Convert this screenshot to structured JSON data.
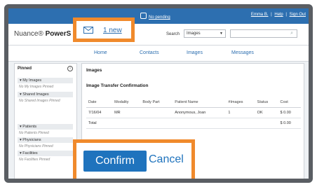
{
  "topbar": {
    "notification_text": "No pending",
    "user_link": "Emma B.",
    "help_link": "Help",
    "signout_link": "Sign Out"
  },
  "brand": {
    "prefix": "Nuance",
    "name": "PowerS"
  },
  "search": {
    "label": "Search",
    "selected": "Images",
    "placeholder": ""
  },
  "nav": {
    "home": "Home",
    "contacts": "Contacts",
    "images": "Images",
    "messages": "Messages"
  },
  "sidebar": {
    "title": "Pinned",
    "sections": [
      {
        "label": "▾ My Images",
        "empty": "No My Images Pinned"
      },
      {
        "label": "▾ Shared Images",
        "empty": "No Shared Images Pinned"
      },
      {
        "label": "▾ Patients",
        "empty": "No Patients Pinned"
      },
      {
        "label": "▾ Physicians",
        "empty": "No Physicians Pinned"
      },
      {
        "label": "▾ Facilities",
        "empty": "No Facilities Pinned"
      }
    ]
  },
  "main": {
    "title": "Images",
    "section": "Image Transfer Confirmation",
    "columns": [
      "Date",
      "Modality",
      "Body Part",
      "Patient Name",
      "#Images",
      "Status",
      "Cost"
    ],
    "rows": [
      [
        "7/16/04",
        "MR",
        "",
        "Anonymous, Joan",
        "1",
        "OK",
        "$ 0.00"
      ],
      [
        "Total",
        "",
        "",
        "",
        "",
        "",
        "$ 0.00"
      ]
    ]
  },
  "callouts": {
    "new_count": "1 new",
    "confirm": "Confirm",
    "cancel": "Cancel"
  },
  "colors": {
    "accent": "#f08a2c",
    "primary": "#1f73bd",
    "topbar": "#2d6fb0"
  }
}
